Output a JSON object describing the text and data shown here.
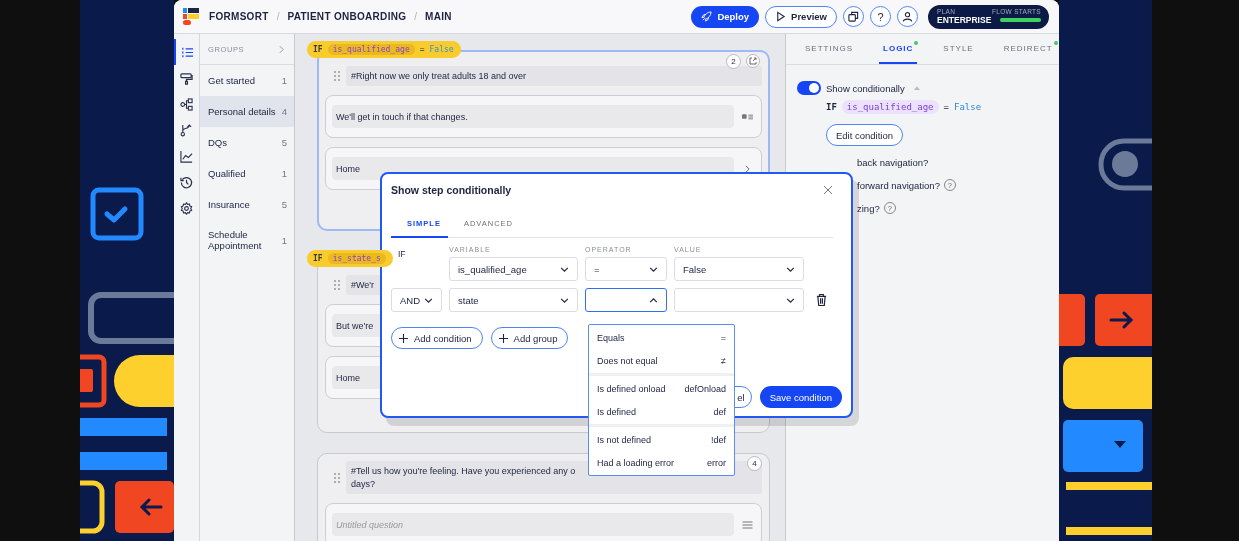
{
  "topbar": {
    "breadcrumbs": [
      "FORMSORT",
      "PATIENT ONBOARDING",
      "MAIN"
    ],
    "separators": [
      "/",
      "/"
    ],
    "deploy": "Deploy",
    "preview": "Preview",
    "help": "?",
    "plan": {
      "label": "PLAN",
      "name": "ENTERPRISE",
      "meter_label": "FLOW STARTS",
      "level": 1
    }
  },
  "rail": [
    {
      "kind": "list",
      "selected": true
    },
    {
      "kind": "roller",
      "selected": false
    },
    {
      "kind": "nodes",
      "selected": false
    },
    {
      "kind": "branch",
      "selected": false
    },
    {
      "kind": "chart",
      "selected": false
    },
    {
      "kind": "history",
      "selected": false
    },
    {
      "kind": "gear",
      "selected": false
    }
  ],
  "groups": {
    "header": "GROUPS",
    "items": [
      {
        "label": "Get started",
        "count": "1",
        "selected": false
      },
      {
        "label": "Personal details",
        "count": "4",
        "selected": true
      },
      {
        "label": "DQs",
        "count": "5",
        "selected": false
      },
      {
        "label": "Qualified",
        "count": "1",
        "selected": false
      },
      {
        "label": "Insurance",
        "count": "5",
        "selected": false
      },
      {
        "label": "Schedule Appointment",
        "count": "1",
        "selected": false
      }
    ]
  },
  "cards": [
    {
      "selected": true,
      "badge": "2",
      "linked": true,
      "condition": {
        "keyword": "IF",
        "variable": "is_qualified_age",
        "operator": "=",
        "value": "False"
      },
      "heading": [
        "#Right now we only treat adults 18 and over"
      ],
      "questions": [
        {
          "kind": "text",
          "text": "We'll get in touch if that changes."
        },
        {
          "kind": "link",
          "text": "Home"
        }
      ]
    },
    {
      "selected": false,
      "condition": {
        "keyword": "IF",
        "variable": "is_state_s"
      },
      "heading": [
        "#We'r"
      ],
      "questions": [
        {
          "kind": "plain",
          "text": "But we're"
        },
        {
          "kind": "plain",
          "text": "Home"
        }
      ]
    },
    {
      "selected": false,
      "badge": "4",
      "heading": [
        "#Tell us how you're feeling. Have you experienced any o",
        "days?"
      ],
      "questions": [
        {
          "kind": "placeholder",
          "text": "Untitled question"
        }
      ]
    }
  ],
  "panel": {
    "tabs": [
      {
        "label": "SETTINGS",
        "selected": false,
        "dot": false
      },
      {
        "label": "LOGIC",
        "selected": true,
        "dot": true
      },
      {
        "label": "STYLE",
        "selected": false,
        "dot": false
      },
      {
        "label": "REDIRECT",
        "selected": false,
        "dot": true
      }
    ],
    "toggle": {
      "label": "Show conditionally",
      "on": true,
      "expanded": true
    },
    "condition": {
      "keyword": "IF",
      "variable": "is_qualified_age",
      "operator": "=",
      "value": "False"
    },
    "edit_button": "Edit condition",
    "options": [
      {
        "text": "back navigation?"
      },
      {
        "text": "forward navigation?",
        "help": "?"
      },
      {
        "text": "zing?",
        "help": "?"
      }
    ]
  },
  "modal": {
    "title": "Show step conditionally",
    "tabs": [
      {
        "label": "SIMPLE",
        "selected": true
      },
      {
        "label": "ADVANCED",
        "selected": false
      }
    ],
    "columns": [
      "VARIABLE",
      "OPERATOR",
      "VALUE"
    ],
    "rows": [
      {
        "kind": "label",
        "connector": "IF",
        "variable": "is_qualified_age",
        "operator": "=",
        "value": "False",
        "operator_open": false,
        "deletable": false
      },
      {
        "kind": "select",
        "connector": "AND",
        "variable": "state",
        "operator_open": true,
        "deletable": true
      }
    ],
    "actions": [
      "Add condition",
      "Add group"
    ],
    "cancel": "el",
    "save": "Save condition"
  },
  "operator_menu": [
    [
      {
        "label": "Equals",
        "symbol": "="
      },
      {
        "label": "Does not equal",
        "symbol": "≠"
      }
    ],
    [
      {
        "label": "Is defined onload",
        "symbol": "defOnload"
      },
      {
        "label": "Is defined",
        "symbol": "def"
      }
    ],
    [
      {
        "label": "Is not defined",
        "symbol": "!def"
      },
      {
        "label": "Had a loading error",
        "symbol": "error"
      }
    ]
  ]
}
